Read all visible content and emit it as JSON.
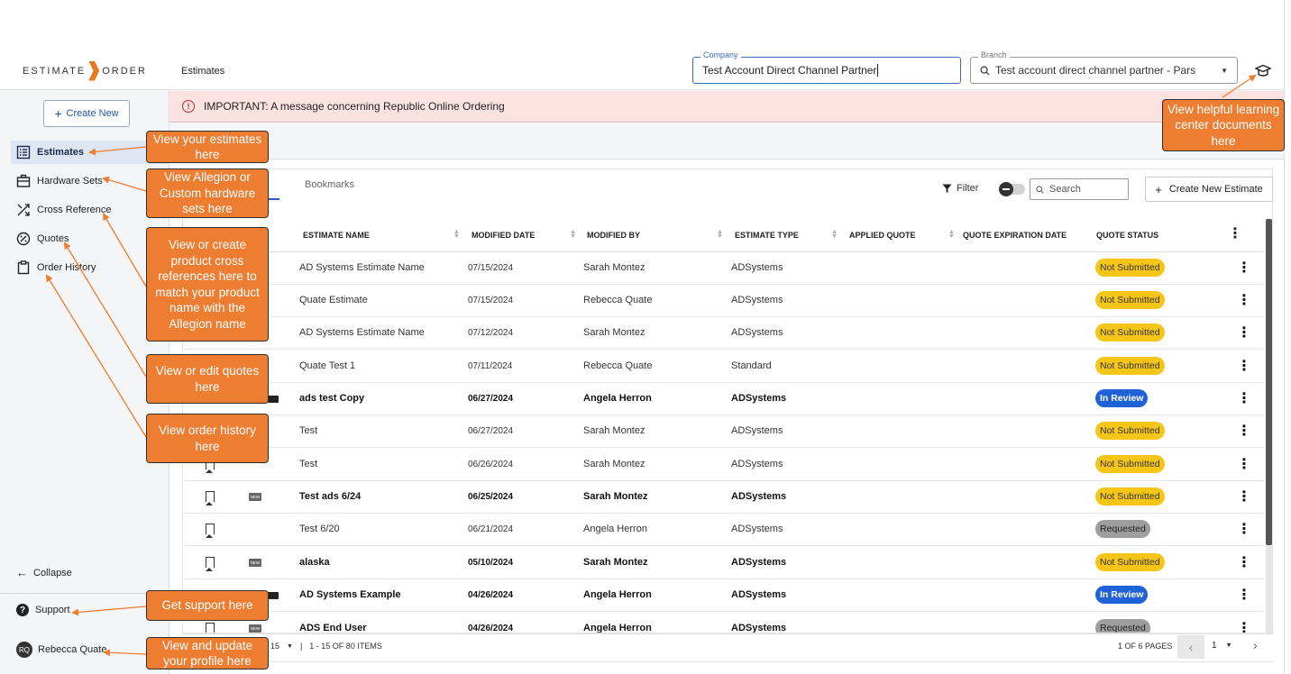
{
  "app": {
    "brand_left": "ESTIMATE",
    "brand_right": "ORDER",
    "page_title": "Estimates"
  },
  "header": {
    "company_label": "Company",
    "company_value": "Test Account Direct Channel Partner",
    "branch_label": "Branch",
    "branch_value": "Test account direct channel partner - Pars"
  },
  "sidebar": {
    "create_new": "Create New",
    "items": [
      {
        "label": "Estimates",
        "icon": "list-icon"
      },
      {
        "label": "Hardware Sets",
        "icon": "briefcase-icon"
      },
      {
        "label": "Cross Reference",
        "icon": "cross-arrows-icon"
      },
      {
        "label": "Quotes",
        "icon": "percent-badge-icon"
      },
      {
        "label": "Order History",
        "icon": "clipboard-icon"
      }
    ],
    "collapse": "Collapse",
    "support": "Support",
    "user_initials": "RQ",
    "user_name": "Rebecca Quate"
  },
  "banner": {
    "text": "IMPORTANT: A message concerning Republic Online Ordering"
  },
  "toolbar": {
    "tab_bookmarks": "Bookmarks",
    "filter": "Filter",
    "search_placeholder": "Search",
    "create_estimate": "Create New Estimate"
  },
  "table": {
    "columns": [
      "ESTIMATE NAME",
      "MODIFIED DATE",
      "MODIFIED BY",
      "ESTIMATE TYPE",
      "APPLIED QUOTE",
      "QUOTE EXPIRATION DATE",
      "QUOTE STATUS"
    ],
    "rows": [
      {
        "name": "AD Systems Estimate Name",
        "date": "07/15/2024",
        "by": "Sarah Montez",
        "type": "ADSystems",
        "status": "Not Submitted"
      },
      {
        "name": "Quate Estimate",
        "date": "07/15/2024",
        "by": "Rebecca Quate",
        "type": "ADSystems",
        "status": "Not Submitted"
      },
      {
        "name": "AD Systems Estimate Name",
        "date": "07/12/2024",
        "by": "Sarah Montez",
        "type": "ADSystems",
        "status": "Not Submitted"
      },
      {
        "name": "Quate Test 1",
        "date": "07/11/2024",
        "by": "Rebecca Quate",
        "type": "Standard",
        "status": "Not Submitted"
      },
      {
        "name": "ads test Copy",
        "date": "06/27/2024",
        "by": "Angela Herron",
        "type": "ADSystems",
        "status": "In Review"
      },
      {
        "name": "Test",
        "date": "06/27/2024",
        "by": "Sarah Montez",
        "type": "ADSystems",
        "status": "Not Submitted"
      },
      {
        "name": "Test",
        "date": "06/26/2024",
        "by": "Sarah Montez",
        "type": "ADSystems",
        "status": "Not Submitted"
      },
      {
        "name": "Test ads 6/24",
        "date": "06/25/2024",
        "by": "Sarah Montez",
        "type": "ADSystems",
        "status": "Not Submitted"
      },
      {
        "name": "Test 6/20",
        "date": "06/21/2024",
        "by": "Angela Herron",
        "type": "ADSystems",
        "status": "Requested"
      },
      {
        "name": "alaska",
        "date": "05/10/2024",
        "by": "Sarah Montez",
        "type": "ADSystems",
        "status": "Not Submitted"
      },
      {
        "name": "AD Systems Example",
        "date": "04/26/2024",
        "by": "Angela Herron",
        "type": "ADSystems",
        "status": "In Review"
      },
      {
        "name": "ADS End User",
        "date": "04/26/2024",
        "by": "Angela Herron",
        "type": "ADSystems",
        "status": "Requested"
      }
    ]
  },
  "pagination": {
    "page_size": "15",
    "range": "1 - 15 OF 80 ITEMS",
    "pages": "1 OF 6 PAGES",
    "current_page": "1"
  },
  "callouts": {
    "estimates": "View your estimates here",
    "hardware": "View  Allegion or Custom hardware sets here",
    "cross": "View or create product cross references here to match your product name with the Allegion name",
    "quotes": "View or edit quotes here",
    "orders": "View order history here",
    "support": "Get support here",
    "profile": "View and update your profile here",
    "learning": "View helpful learning center documents here"
  },
  "colors": {
    "callout": "#ed7d31",
    "accent": "#2a5cc4",
    "not_submitted": "#f5c518",
    "in_review": "#1f62d8",
    "requested": "#9e9e9e"
  }
}
